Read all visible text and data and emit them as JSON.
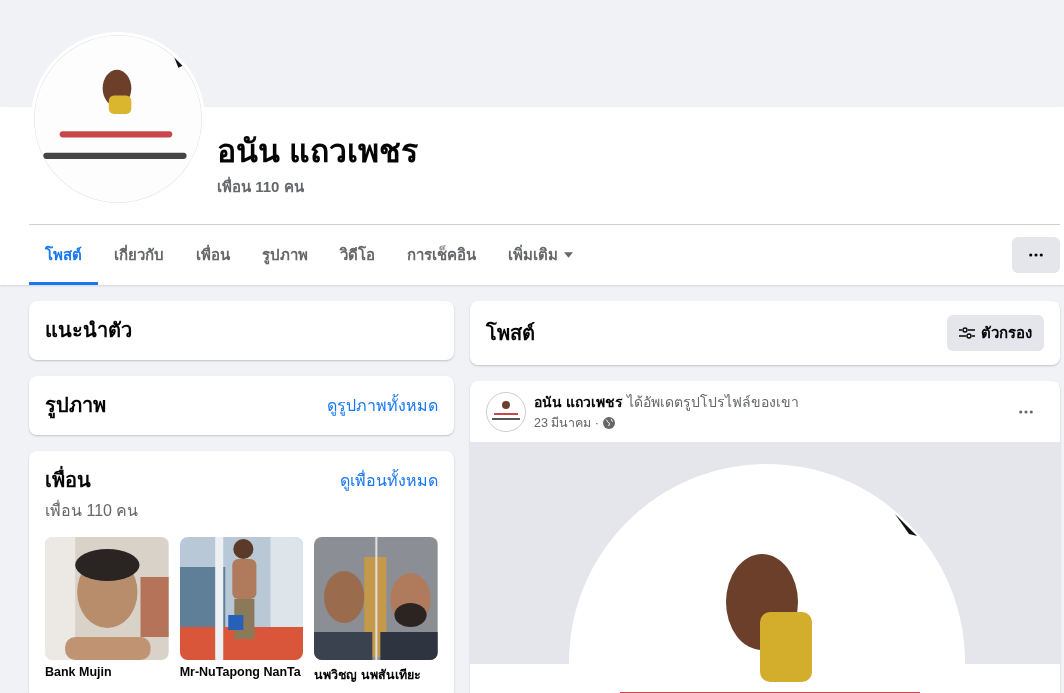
{
  "profile": {
    "name": "อนัน แถวเพชร",
    "friend_count": "เพื่อน 110 คน"
  },
  "tabs": [
    {
      "label": "โพสต์",
      "selected": true,
      "dropdown": false
    },
    {
      "label": "เกี่ยวกับ",
      "selected": false,
      "dropdown": false
    },
    {
      "label": "เพื่อน",
      "selected": false,
      "dropdown": false
    },
    {
      "label": "รูปภาพ",
      "selected": false,
      "dropdown": false
    },
    {
      "label": "วิดีโอ",
      "selected": false,
      "dropdown": false
    },
    {
      "label": "การเช็คอิน",
      "selected": false,
      "dropdown": false
    },
    {
      "label": "เพิ่มเติม",
      "selected": false,
      "dropdown": true
    }
  ],
  "intro": {
    "title": "แนะนำตัว"
  },
  "photos": {
    "title": "รูปภาพ",
    "link": "ดูรูปภาพทั้งหมด"
  },
  "friends": {
    "title": "เพื่อน",
    "count": "เพื่อน 110 คน",
    "link": "ดูเพื่อนทั้งหมด",
    "items": [
      {
        "name": "Bank Mujin"
      },
      {
        "name": "Mr-NuTapong NanTa"
      },
      {
        "name": "นพวิชญ นพสันเทียะ"
      }
    ]
  },
  "posts_header": {
    "title": "โพสต์",
    "filter_button": "ตัวกรอง"
  },
  "post": {
    "author": "อนัน แถวเพชร",
    "action": "ได้อัพเดตรูปโปรไฟล์ของเขา",
    "date": "23 มีนาคม ·"
  }
}
